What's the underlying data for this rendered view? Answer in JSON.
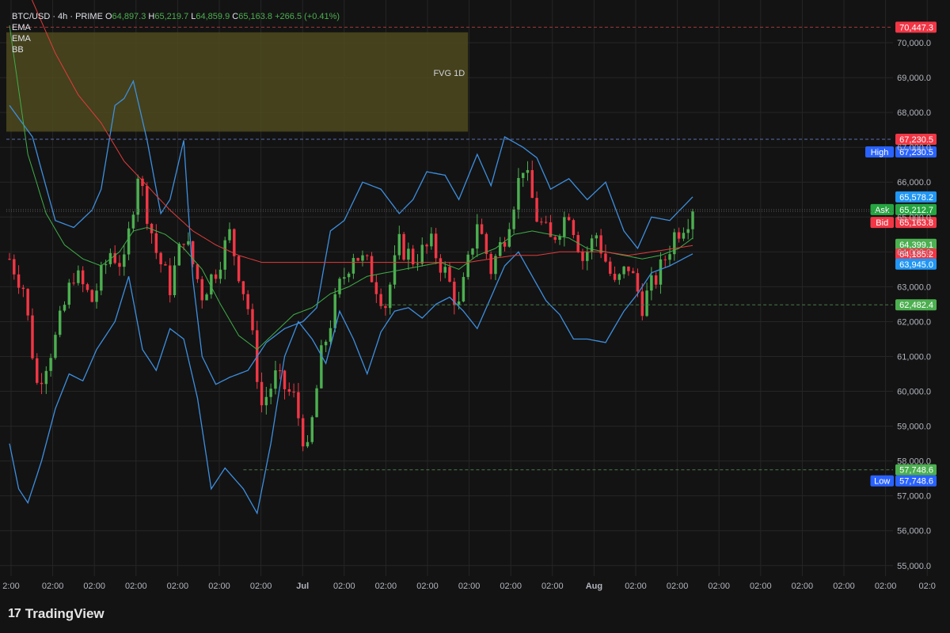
{
  "legend": {
    "symbol": "BTC/USD · 4h · PRIME",
    "o_label": "O",
    "o": "64,897.3",
    "h_label": "H",
    "h": "65,219.7",
    "l_label": "L",
    "l": "64,859.9",
    "c_label": "C",
    "c": "65,163.8",
    "change": "+266.5 (+0.41%)",
    "indicators": [
      "EMA",
      "EMA",
      "BB"
    ]
  },
  "brand": {
    "logo": "17",
    "name": "TradingView"
  },
  "colors": {
    "up": "#26a69a",
    "up_candle": "#4caf50",
    "down": "#f23645",
    "bb": "#3d8fe0",
    "ema_fast": "#3fae49",
    "ema_slow": "#e23b3b",
    "fvg": "#4d4a1e",
    "grid": "#262626"
  },
  "chart_data": {
    "type": "line",
    "title": "BTC/USD · 4h · PRIME",
    "ylim": [
      54700,
      71000
    ],
    "y_ticks": [
      "70,000.0",
      "69,000.0",
      "68,000.0",
      "67,000.0",
      "66,000.0",
      "65,000.0",
      "64,000.0",
      "63,000.0",
      "62,000.0",
      "61,000.0",
      "60,000.0",
      "59,000.0",
      "58,000.0",
      "57,000.0",
      "56,000.0",
      "55,000.0"
    ],
    "y_tick_values": [
      70000,
      69000,
      68000,
      67000,
      66000,
      65000,
      64000,
      63000,
      62000,
      61000,
      60000,
      59000,
      58000,
      57000,
      56000,
      55000
    ],
    "x_ticks": [
      "2:00",
      "02:00",
      "02:00",
      "02:00",
      "02:00",
      "02:00",
      "02:00",
      "Jul",
      "02:00",
      "02:00",
      "02:00",
      "02:00",
      "02:00",
      "02:00",
      "Aug",
      "02:00",
      "02:00",
      "02:00",
      "02:00",
      "02:00",
      "02:00",
      "02:00",
      "02:0"
    ],
    "x_tick_index": [
      0,
      1,
      2,
      3,
      4,
      5,
      6,
      7,
      8,
      9,
      10,
      11,
      12,
      13,
      14,
      15,
      16,
      17,
      18,
      19,
      20,
      21,
      22
    ],
    "x_tick_count": 23,
    "candle_count": 150,
    "close_path": [
      [
        0,
        63800
      ],
      [
        3,
        63000
      ],
      [
        6,
        60200
      ],
      [
        10,
        61500
      ],
      [
        14,
        63400
      ],
      [
        18,
        62600
      ],
      [
        22,
        64000
      ],
      [
        25,
        63600
      ],
      [
        28,
        66300
      ],
      [
        32,
        64000
      ],
      [
        35,
        63000
      ],
      [
        38,
        64500
      ],
      [
        42,
        62800
      ],
      [
        45,
        63500
      ],
      [
        48,
        64500
      ],
      [
        52,
        62400
      ],
      [
        55,
        59600
      ],
      [
        58,
        60400
      ],
      [
        62,
        59800
      ],
      [
        65,
        58200
      ],
      [
        68,
        61000
      ],
      [
        72,
        63000
      ],
      [
        75,
        64000
      ],
      [
        78,
        63600
      ],
      [
        82,
        62500
      ],
      [
        85,
        64200
      ],
      [
        88,
        63800
      ],
      [
        92,
        64200
      ],
      [
        95,
        63400
      ],
      [
        98,
        62400
      ],
      [
        102,
        64900
      ],
      [
        105,
        63500
      ],
      [
        108,
        64500
      ],
      [
        112,
        66500
      ],
      [
        115,
        65000
      ],
      [
        118,
        64300
      ],
      [
        122,
        65200
      ],
      [
        125,
        63800
      ],
      [
        128,
        64500
      ],
      [
        132,
        63000
      ],
      [
        135,
        63600
      ],
      [
        138,
        62500
      ],
      [
        142,
        63500
      ],
      [
        145,
        64500
      ],
      [
        149,
        65163.8
      ]
    ],
    "bb_upper": [
      [
        0,
        68200
      ],
      [
        5,
        67300
      ],
      [
        10,
        64900
      ],
      [
        14,
        64700
      ],
      [
        18,
        65200
      ],
      [
        20,
        65800
      ],
      [
        23,
        68200
      ],
      [
        25,
        68400
      ],
      [
        27,
        68900
      ],
      [
        30,
        67200
      ],
      [
        33,
        65100
      ],
      [
        35,
        65500
      ],
      [
        38,
        67200
      ],
      [
        40,
        63200
      ],
      [
        42,
        61000
      ],
      [
        45,
        60200
      ],
      [
        48,
        60400
      ],
      [
        52,
        60600
      ],
      [
        56,
        61400
      ],
      [
        60,
        61800
      ],
      [
        64,
        62000
      ],
      [
        67,
        62400
      ],
      [
        70,
        64600
      ],
      [
        73,
        64900
      ],
      [
        77,
        66000
      ],
      [
        81,
        65800
      ],
      [
        85,
        65100
      ],
      [
        88,
        65500
      ],
      [
        91,
        66300
      ],
      [
        95,
        66200
      ],
      [
        98,
        65500
      ],
      [
        102,
        66800
      ],
      [
        105,
        65900
      ],
      [
        108,
        67300
      ],
      [
        112,
        67000
      ],
      [
        115,
        66700
      ],
      [
        118,
        65800
      ],
      [
        122,
        66100
      ],
      [
        126,
        65500
      ],
      [
        130,
        66000
      ],
      [
        134,
        64600
      ],
      [
        137,
        64100
      ],
      [
        140,
        65000
      ],
      [
        144,
        64900
      ],
      [
        149,
        65578.2
      ]
    ],
    "bb_lower": [
      [
        0,
        58500
      ],
      [
        2,
        57200
      ],
      [
        4,
        56800
      ],
      [
        7,
        58000
      ],
      [
        10,
        59500
      ],
      [
        13,
        60500
      ],
      [
        16,
        60300
      ],
      [
        19,
        61200
      ],
      [
        23,
        62000
      ],
      [
        26,
        63300
      ],
      [
        29,
        61200
      ],
      [
        32,
        60600
      ],
      [
        35,
        61800
      ],
      [
        38,
        61500
      ],
      [
        41,
        59800
      ],
      [
        44,
        57200
      ],
      [
        47,
        57800
      ],
      [
        51,
        57200
      ],
      [
        54,
        56500
      ],
      [
        57,
        58500
      ],
      [
        60,
        61000
      ],
      [
        63,
        62000
      ],
      [
        66,
        61500
      ],
      [
        69,
        60800
      ],
      [
        72,
        62300
      ],
      [
        75,
        61500
      ],
      [
        78,
        60500
      ],
      [
        81,
        61700
      ],
      [
        84,
        62300
      ],
      [
        87,
        62400
      ],
      [
        90,
        62100
      ],
      [
        93,
        62500
      ],
      [
        96,
        62700
      ],
      [
        99,
        62300
      ],
      [
        102,
        61800
      ],
      [
        105,
        62700
      ],
      [
        108,
        63600
      ],
      [
        111,
        64000
      ],
      [
        114,
        63300
      ],
      [
        117,
        62600
      ],
      [
        120,
        62200
      ],
      [
        123,
        61500
      ],
      [
        126,
        61500
      ],
      [
        130,
        61400
      ],
      [
        134,
        62300
      ],
      [
        137,
        62800
      ],
      [
        140,
        63400
      ],
      [
        144,
        63600
      ],
      [
        149,
        63945.0
      ]
    ],
    "ema_fast": [
      [
        0,
        70500
      ],
      [
        4,
        66800
      ],
      [
        8,
        65100
      ],
      [
        12,
        64200
      ],
      [
        16,
        63800
      ],
      [
        20,
        63600
      ],
      [
        24,
        64000
      ],
      [
        27,
        64600
      ],
      [
        30,
        64700
      ],
      [
        34,
        64500
      ],
      [
        38,
        64100
      ],
      [
        42,
        63500
      ],
      [
        46,
        62500
      ],
      [
        50,
        61600
      ],
      [
        54,
        61200
      ],
      [
        58,
        61700
      ],
      [
        62,
        62200
      ],
      [
        66,
        62400
      ],
      [
        70,
        62800
      ],
      [
        74,
        63000
      ],
      [
        78,
        63300
      ],
      [
        82,
        63400
      ],
      [
        86,
        63500
      ],
      [
        90,
        63600
      ],
      [
        94,
        63700
      ],
      [
        98,
        63500
      ],
      [
        102,
        63900
      ],
      [
        106,
        64100
      ],
      [
        110,
        64500
      ],
      [
        114,
        64600
      ],
      [
        118,
        64500
      ],
      [
        122,
        64400
      ],
      [
        126,
        64100
      ],
      [
        130,
        64000
      ],
      [
        134,
        63900
      ],
      [
        138,
        63800
      ],
      [
        142,
        63900
      ],
      [
        146,
        64100
      ],
      [
        149,
        64399.1
      ]
    ],
    "ema_slow": [
      [
        0,
        72800
      ],
      [
        5,
        71200
      ],
      [
        10,
        69700
      ],
      [
        15,
        68500
      ],
      [
        20,
        67700
      ],
      [
        25,
        66600
      ],
      [
        30,
        65900
      ],
      [
        35,
        65200
      ],
      [
        40,
        64600
      ],
      [
        45,
        64200
      ],
      [
        50,
        63900
      ],
      [
        55,
        63700
      ],
      [
        60,
        63700
      ],
      [
        65,
        63700
      ],
      [
        70,
        63700
      ],
      [
        75,
        63700
      ],
      [
        80,
        63700
      ],
      [
        85,
        63700
      ],
      [
        90,
        63700
      ],
      [
        95,
        63700
      ],
      [
        100,
        63700
      ],
      [
        105,
        63800
      ],
      [
        110,
        63900
      ],
      [
        115,
        63900
      ],
      [
        120,
        64000
      ],
      [
        125,
        64000
      ],
      [
        130,
        64000
      ],
      [
        135,
        63900
      ],
      [
        140,
        64000
      ],
      [
        145,
        64100
      ],
      [
        149,
        64185.2
      ]
    ],
    "fvg": {
      "label": "FVG 1D",
      "y_top": 70300,
      "y_bottom": 67450,
      "x_end_index": 100
    },
    "levels": [
      {
        "value": 70447.3,
        "label": "70,447.3",
        "tag": "",
        "color": "#f23645",
        "style": "dashed",
        "line_color": "#a33a3a"
      },
      {
        "value": 67230.5,
        "label": "67,230.5",
        "tag": "",
        "color": "#f23645",
        "style": "none"
      },
      {
        "value": 67230.5,
        "label": "67,230.5",
        "tag": "High",
        "color": "#2962ff",
        "style": "dashed",
        "line_color": "#5a6fb0",
        "offset": 16
      },
      {
        "value": 65578.2,
        "label": "65,578.2",
        "tag": "",
        "color": "#2196f3",
        "style": "none"
      },
      {
        "value": 65212.7,
        "label": "65,212.7",
        "tag": "Ask",
        "color": "#26a641",
        "style": "dotted",
        "line_color": "#555"
      },
      {
        "value": 65163.8,
        "label": "65,163.8",
        "tag": "Bid",
        "color": "#f23645",
        "style": "dotted",
        "line_color": "#555",
        "offset": 14
      },
      {
        "value": 64399.1,
        "label": "64,399.1",
        "tag": "",
        "color": "#4caf50",
        "style": "none",
        "offset": 8
      },
      {
        "value": 64185.2,
        "label": "64,185.2",
        "tag": "",
        "color": "#f23645",
        "style": "none",
        "offset": 11
      },
      {
        "value": 63945.0,
        "label": "63,945.0",
        "tag": "",
        "color": "#2196f3",
        "style": "none",
        "offset": 13
      },
      {
        "value": 62482.4,
        "label": "62,482.4",
        "tag": "",
        "color": "#4caf50",
        "style": "dashed",
        "line_color": "#4a7a4a",
        "start_index": 81
      },
      {
        "value": 57748.6,
        "label": "57,748.6",
        "tag": "",
        "color": "#4caf50",
        "style": "dashed",
        "line_color": "#4a7a4a",
        "start_index": 51
      },
      {
        "value": 57748.6,
        "label": "57,748.6",
        "tag": "Low",
        "color": "#2962ff",
        "style": "none",
        "offset": 14
      }
    ]
  }
}
